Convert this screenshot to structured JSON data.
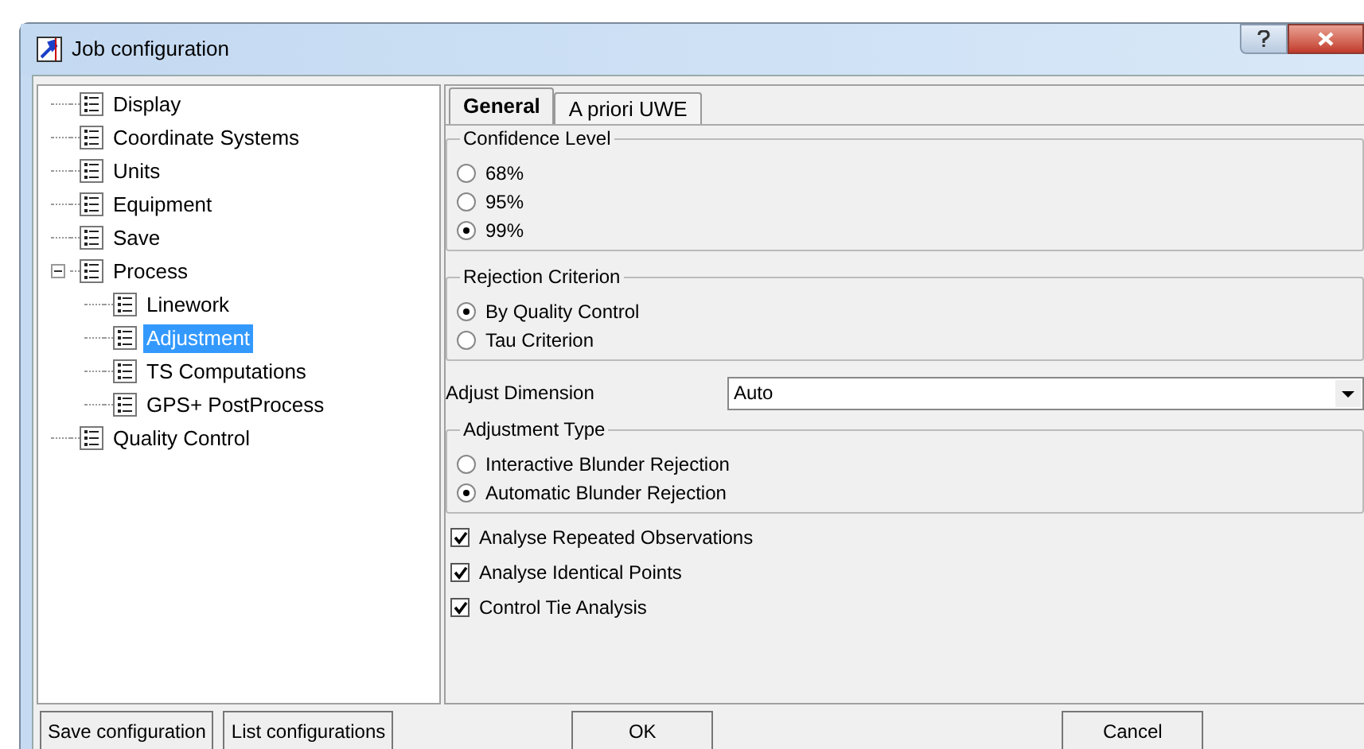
{
  "window": {
    "title": "Job configuration"
  },
  "tree": [
    {
      "label": "Display",
      "selected": false
    },
    {
      "label": "Coordinate Systems",
      "selected": false
    },
    {
      "label": "Units",
      "selected": false
    },
    {
      "label": "Equipment",
      "selected": false
    },
    {
      "label": "Save",
      "selected": false
    },
    {
      "label": "Process",
      "selected": false,
      "expanded": true,
      "children": [
        {
          "label": "Linework",
          "selected": false
        },
        {
          "label": "Adjustment",
          "selected": true
        },
        {
          "label": "TS Computations",
          "selected": false
        },
        {
          "label": "GPS+ PostProcess",
          "selected": false
        }
      ]
    },
    {
      "label": "Quality Control",
      "selected": false
    }
  ],
  "tabs": [
    {
      "label": "General",
      "selected": true
    },
    {
      "label": "A priori UWE",
      "selected": false
    }
  ],
  "confidence_level": {
    "title": "Confidence Level",
    "options": [
      {
        "label": "68%",
        "selected": false
      },
      {
        "label": "95%",
        "selected": false
      },
      {
        "label": "99%",
        "selected": true
      }
    ]
  },
  "rejection_criterion": {
    "title": "Rejection Criterion",
    "options": [
      {
        "label": "By Quality Control",
        "selected": true
      },
      {
        "label": "Tau Criterion",
        "selected": false
      }
    ]
  },
  "adjust_dimension": {
    "label": "Adjust Dimension",
    "value": "Auto"
  },
  "adjustment_type": {
    "title": "Adjustment Type",
    "options": [
      {
        "label": "Interactive Blunder Rejection",
        "selected": false
      },
      {
        "label": "Automatic Blunder Rejection",
        "selected": true
      }
    ]
  },
  "checkboxes": [
    {
      "label": "Analyse Repeated Observations",
      "checked": true
    },
    {
      "label": "Analyse Identical Points",
      "checked": true
    },
    {
      "label": "Control Tie Analysis",
      "checked": true
    }
  ],
  "left_buttons": [
    "Save configuration",
    "List configurations"
  ],
  "dialog_buttons": [
    "OK",
    "Cancel"
  ]
}
